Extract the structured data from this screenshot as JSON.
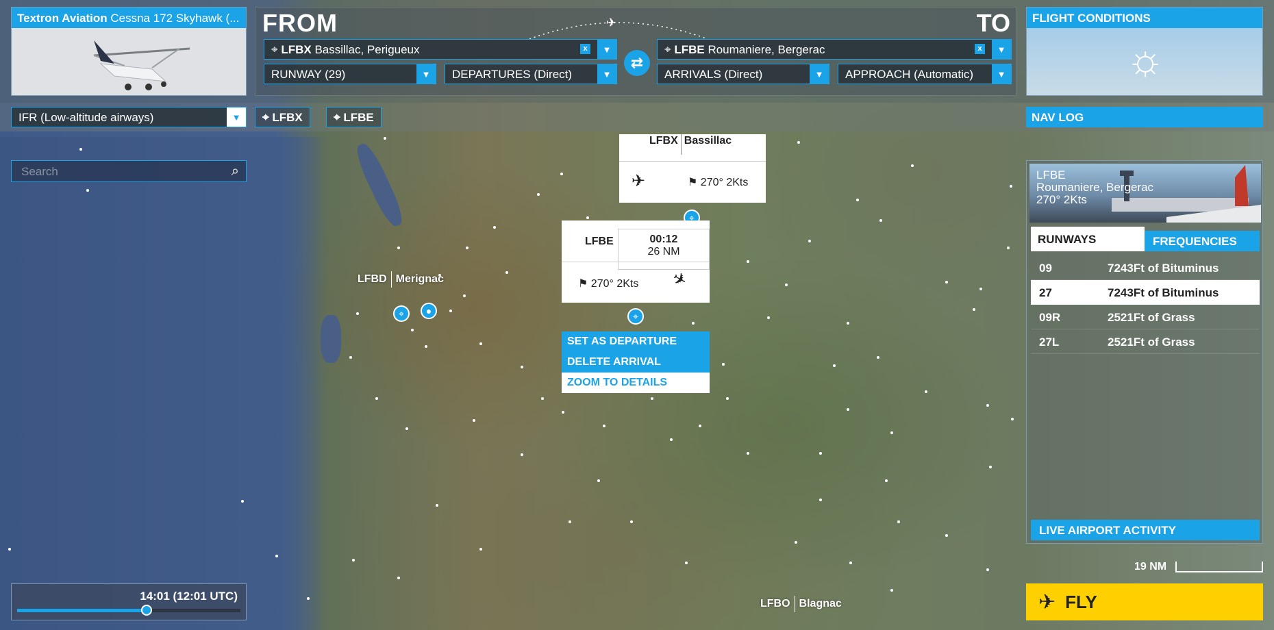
{
  "aircraft": {
    "brand": "Textron Aviation",
    "model": "Cessna 172 Skyhawk (..."
  },
  "route": {
    "from_label": "FROM",
    "to_label": "TO",
    "departure": {
      "code": "LFBX",
      "name": "Bassillac, Perigueux"
    },
    "arrival": {
      "code": "LFBE",
      "name": "Roumaniere, Bergerac"
    },
    "runway": "RUNWAY (29)",
    "departures": "DEPARTURES (Direct)",
    "arrivals": "ARRIVALS (Direct)",
    "approach": "APPROACH (Automatic)",
    "swap_icon": "swap-icon"
  },
  "conditions": {
    "title": "FLIGHT CONDITIONS",
    "icon": "sun-icon"
  },
  "flight_type": "IFR (Low-altitude airways)",
  "waypoints": [
    "LFBX",
    "LFBE"
  ],
  "nav_log": "NAV LOG",
  "search": {
    "placeholder": "Search"
  },
  "map": {
    "departure_card": {
      "code": "LFBX",
      "name": "Bassillac",
      "wind": "270° 2Kts"
    },
    "arrival_card": {
      "code": "LFBE",
      "time": "00:12",
      "distance": "26 NM",
      "wind": "270° 2Kts"
    },
    "context_menu": [
      "SET AS DEPARTURE",
      "DELETE ARRIVAL",
      "ZOOM TO DETAILS"
    ],
    "labels": [
      {
        "code": "LFBD",
        "name": "Merignac"
      },
      {
        "code": "LFBO",
        "name": "Blagnac"
      }
    ],
    "scale": "19 NM"
  },
  "airport_info": {
    "code": "LFBE",
    "name": "Roumaniere, Bergerac",
    "wind": "270° 2Kts",
    "tabs": [
      "RUNWAYS",
      "FREQUENCIES"
    ],
    "runways": [
      {
        "id": "09",
        "desc": "7243Ft of Bituminus"
      },
      {
        "id": "27",
        "desc": "7243Ft of Bituminus"
      },
      {
        "id": "09R",
        "desc": "2521Ft of Grass"
      },
      {
        "id": "27L",
        "desc": "2521Ft of Grass"
      }
    ],
    "live": "LIVE AIRPORT ACTIVITY"
  },
  "time": {
    "label": "14:01 (12:01 UTC)",
    "progress": 0.58
  },
  "fly": "FLY",
  "colors": {
    "accent": "#1ba3e8",
    "fly": "#ffd000"
  }
}
